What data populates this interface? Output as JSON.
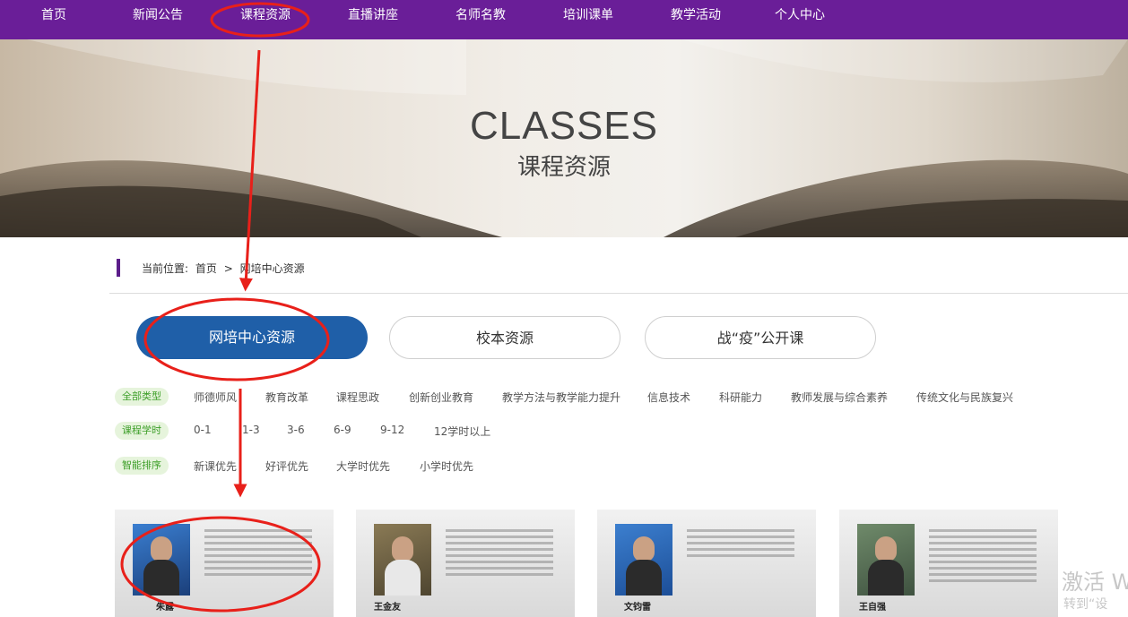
{
  "nav": {
    "items": [
      "首页",
      "新闻公告",
      "课程资源",
      "直播讲座",
      "名师名教",
      "培训课单",
      "教学活动",
      "个人中心"
    ]
  },
  "banner": {
    "title_en": "CLASSES",
    "title_zh": "课程资源"
  },
  "breadcrumb": {
    "prefix": "当前位置:",
    "home": "首页",
    "sep": ">",
    "current": "网培中心资源"
  },
  "tabs": [
    {
      "label": "网培中心资源",
      "active": true
    },
    {
      "label": "校本资源",
      "active": false
    },
    {
      "label": "战“疫”公开课",
      "active": false
    }
  ],
  "filters": {
    "type": {
      "tag": "全部类型",
      "options": [
        "师德师风",
        "教育改革",
        "课程思政",
        "创新创业教育",
        "教学方法与教学能力提升",
        "信息技术",
        "科研能力",
        "教师发展与综合素养",
        "传统文化与民族复兴"
      ]
    },
    "hours": {
      "tag": "课程学时",
      "options": [
        "0-1",
        "1-3",
        "3-6",
        "6-9",
        "9-12",
        "12学时以上"
      ]
    },
    "sort": {
      "tag": "智能排序",
      "options": [
        "新课优先",
        "好评优先",
        "大学时优先",
        "小学时优先"
      ]
    }
  },
  "cards": [
    {
      "name": "朱露"
    },
    {
      "name": "王金友"
    },
    {
      "name": "文钧雷"
    },
    {
      "name": "王自强"
    }
  ],
  "watermark": {
    "line1": "激活 W",
    "line2": "转到“设"
  },
  "colors": {
    "nav_bg": "#6a1e98",
    "tab_active": "#1f5fa8",
    "filter_tag": "#3e9f2a",
    "annotation": "#e8201a"
  }
}
